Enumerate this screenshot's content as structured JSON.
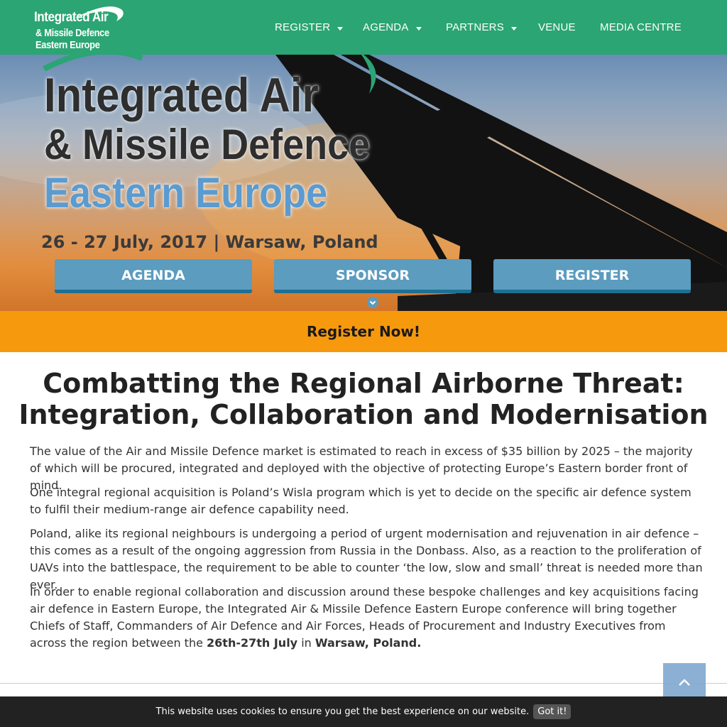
{
  "brand": {
    "logo_line1": "Integrated Air",
    "logo_line2": "& Missile Defence",
    "logo_line3": "Eastern Europe",
    "primary_color": "#2ba573",
    "accent_color": "#f7990c",
    "button_color": "#5b9cbf"
  },
  "nav": {
    "items": [
      {
        "label": "REGISTER",
        "dropdown": true
      },
      {
        "label": "AGENDA",
        "dropdown": true
      },
      {
        "label": "PARTNERS",
        "dropdown": true
      },
      {
        "label": "VENUE",
        "dropdown": false
      },
      {
        "label": "MEDIA CENTRE",
        "dropdown": false
      }
    ]
  },
  "hero": {
    "title_line1": "Integrated Air",
    "title_line2": "& Missile Defence",
    "title_line3": "Eastern Europe",
    "date_location": "26 - 27 July, 2017 | Warsaw, Poland",
    "buttons": [
      {
        "label": "AGENDA"
      },
      {
        "label": "SPONSOR"
      },
      {
        "label": "REGISTER"
      }
    ],
    "scroll_icon": "chevron-down-circle-icon"
  },
  "register_band": {
    "label": "Register Now!"
  },
  "main": {
    "headline_line1": "Combatting the Regional Airborne Threat:",
    "headline_line2": "Integration, Collaboration and Modernisation",
    "paragraphs": [
      "The value of the Air and Missile Defence market is estimated to reach in excess of $35 billion by 2025 – the majority of which will be procured, integrated and deployed with the objective of protecting  Europe’s Eastern border front of mind.",
      "One integral regional acquisition is Poland’s Wisla program which is yet to decide on the specific air defence system to fulfil their medium-range air defence capability need.",
      "Poland, alike its regional neighbours is undergoing a period of urgent modernisation and rejuvenation in air defence – this comes as a result of the ongoing aggression from Russia in the Donbass. Also, as a reaction to the proliferation of UAVs into the battlespace, the requirement to be able to counter ‘the low, slow and small’ threat is needed more than ever."
    ],
    "p4_text1": "In order to enable regional collaboration and discussion around these bespoke challenges and key acquisitions facing air defence in Eastern Europe, the Integrated Air & Missile Defence Eastern Europe conference will bring together Chiefs of Staff, Commanders of Air Defence and Air Forces, Heads of Procurement and Industry Executives from across the region between the ",
    "p4_bold1": "26th-27th July",
    "p4_text2": " in ",
    "p4_bold2": "Warsaw, Poland."
  },
  "back_to_top": {
    "icon": "chevron-up-icon"
  },
  "cookie": {
    "text": "This website uses cookies to ensure you get the best experience on our website.",
    "button": "Got it!"
  }
}
